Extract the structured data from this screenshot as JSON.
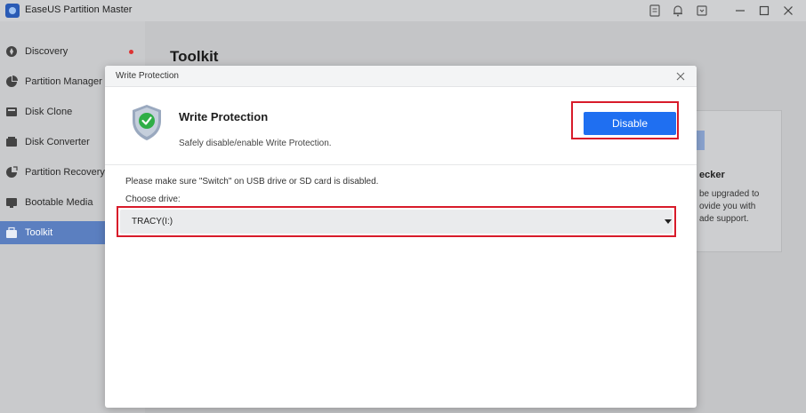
{
  "app": {
    "title": "EaseUS Partition Master"
  },
  "titlebar": {
    "icons": [
      "feedback-icon",
      "bell-icon",
      "download-icon",
      "minimize-icon",
      "maximize-icon",
      "close-icon"
    ]
  },
  "sidebar": {
    "items": [
      {
        "label": "Discovery",
        "icon": "compass-icon"
      },
      {
        "label": "Partition Manager",
        "icon": "pie-chart-icon"
      },
      {
        "label": "Disk Clone",
        "icon": "disk-clone-icon"
      },
      {
        "label": "Disk Converter",
        "icon": "disk-converter-icon"
      },
      {
        "label": "Partition Recovery",
        "icon": "recovery-icon"
      },
      {
        "label": "Bootable Media",
        "icon": "bootable-media-icon"
      },
      {
        "label": "Toolkit",
        "icon": "toolkit-icon"
      }
    ],
    "active": "Toolkit"
  },
  "main": {
    "title": "Toolkit",
    "card": {
      "title": "ecker",
      "lines": [
        "be upgraded to",
        "ovide you with",
        "ade support."
      ]
    }
  },
  "modal": {
    "title": "Write Protection",
    "heading": "Write Protection",
    "description": "Safely disable/enable Write Protection.",
    "button_label": "Disable",
    "note": "Please make sure \"Switch\" on USB drive or SD card is disabled.",
    "choose_label": "Choose drive:",
    "drive_value": "TRACY(I:)"
  },
  "colors": {
    "accent": "#1f6ff1",
    "highlight": "#d81b2a",
    "sidebar_active": "#5b7fc0"
  }
}
